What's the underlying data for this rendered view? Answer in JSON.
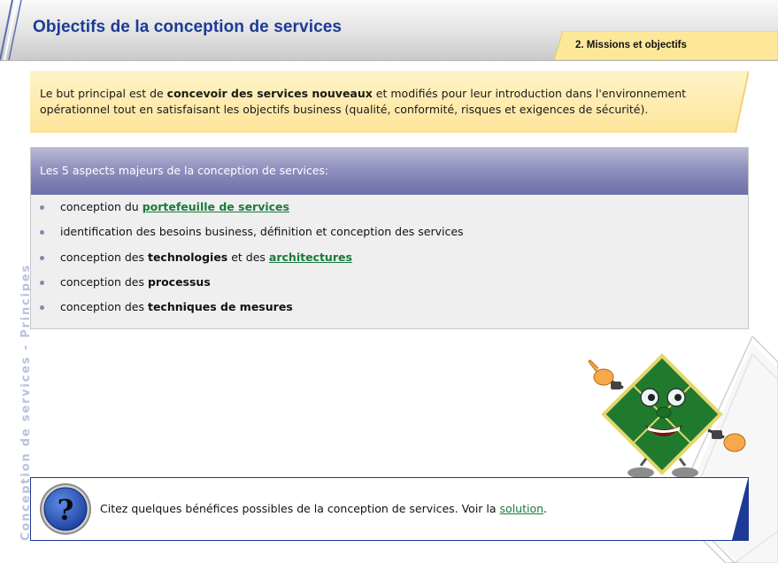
{
  "header": {
    "title": "Objectifs de la conception de services",
    "section_tab": "2. Missions et objectifs"
  },
  "side_label": "Conception de services - Principes",
  "intro": {
    "part1": "Le but principal  est de ",
    "bold": "concevoir des services nouveaux",
    "part2": " et modifiés pour leur introduction dans l'environnement opérationnel tout en satisfaisant les objectifs business (qualité, conformité, risques et exigences de sécurité)."
  },
  "aspects": {
    "heading": "Les 5 aspects majeurs de la conception de services:",
    "items": [
      {
        "prefix": "conception du ",
        "link": "portefeuille de services"
      },
      {
        "text": "identification des besoins business, définition et conception des services"
      },
      {
        "prefix": "conception des ",
        "bold": "technologies",
        "middle": " et des ",
        "link": "architectures"
      },
      {
        "prefix": "conception des ",
        "bold": "processus"
      },
      {
        "prefix": "conception des ",
        "bold": "techniques de mesures"
      }
    ]
  },
  "question": {
    "text": "Citez quelques bénéfices possibles de la conception de services. Voir la ",
    "link": "solution",
    "suffix": ".",
    "icon": "question-mark-icon"
  },
  "colors": {
    "title_blue": "#1c3a96",
    "tab_yellow": "#fde89a",
    "link_green": "#1a7a3a",
    "panel_header": "#8f91be",
    "mascot_green": "#1f7a2e"
  }
}
